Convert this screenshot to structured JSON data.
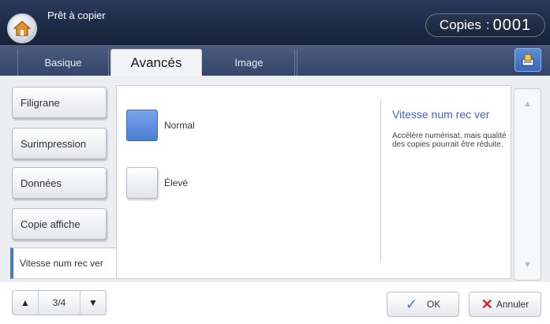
{
  "header": {
    "title": "Prêt à copier",
    "copies_label": "Copies",
    "copies_value": "0001"
  },
  "tabs": [
    {
      "label": "Basique"
    },
    {
      "label": "Avancés"
    },
    {
      "label": "Image"
    }
  ],
  "sidebar": {
    "items": [
      {
        "label": "Filigrane"
      },
      {
        "label": "Surimpression"
      },
      {
        "label": "Données"
      },
      {
        "label": "Copie affiche"
      },
      {
        "label": "Vitesse num rec ver"
      }
    ]
  },
  "options": [
    {
      "label": "Normal"
    },
    {
      "label": "Élevé"
    }
  ],
  "help": {
    "title": "Vitesse num rec ver",
    "text": "Accélère numérisat, mais qualité des copies pourrait être réduite."
  },
  "pager": {
    "page": "3/4"
  },
  "footer": {
    "ok_label": "OK",
    "cancel_label": "Annuler"
  },
  "colors": {
    "accent": "#4c7ed2",
    "header_bg": "#1b2a45",
    "help_title": "#3a63c8"
  }
}
